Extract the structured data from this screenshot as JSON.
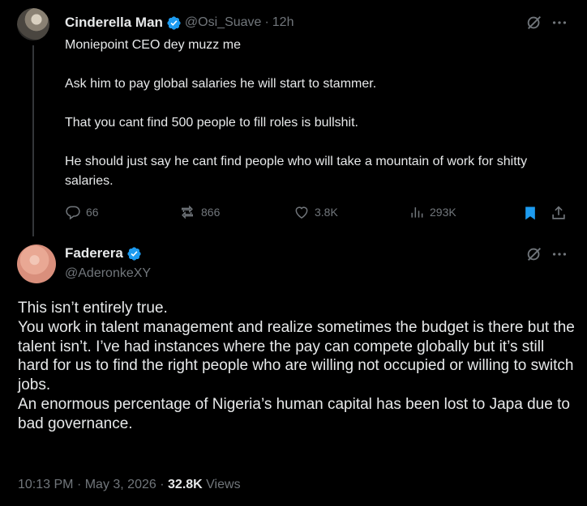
{
  "tweet1": {
    "name": "Cinderella Man",
    "handle": "@Osi_Suave",
    "separator": "·",
    "time": "12h",
    "lines": [
      "Moniepoint CEO dey muzz me",
      "Ask him to pay global salaries he will start to stammer.",
      "That you cant find 500 people to fill roles is bullshit.",
      "He should just say he cant find people who will take a mountain of work for shitty salaries."
    ],
    "replies": "66",
    "reposts": "866",
    "likes": "3.8K",
    "views": "293K"
  },
  "tweet2": {
    "name": "Faderera",
    "handle": "@AderonkeXY",
    "lines": [
      "This isn’t entirely true.",
      "You work in talent management and realize sometimes the budget is there but the talent isn’t. I’ve had instances where the pay can compete globally but it’s still hard for us to find the right people who are willing not occupied or willing to switch jobs.",
      "An enormous percentage of Nigeria’s human capital has been lost to Japa due to bad governance."
    ],
    "time": "10:13 PM",
    "separator": "·",
    "date": "May 3, 2026",
    "views_count": "32.8K",
    "views_label": "Views"
  },
  "colors": {
    "background": "#000000",
    "text": "#e7e9ea",
    "muted": "#71767b",
    "verified": "#1d9bf0",
    "bookmark": "#1d9bf0"
  },
  "icons": [
    "verified-badge-icon",
    "grok-icon",
    "more-icon",
    "reply-icon",
    "repost-icon",
    "like-icon",
    "views-icon",
    "bookmark-icon",
    "share-icon"
  ]
}
